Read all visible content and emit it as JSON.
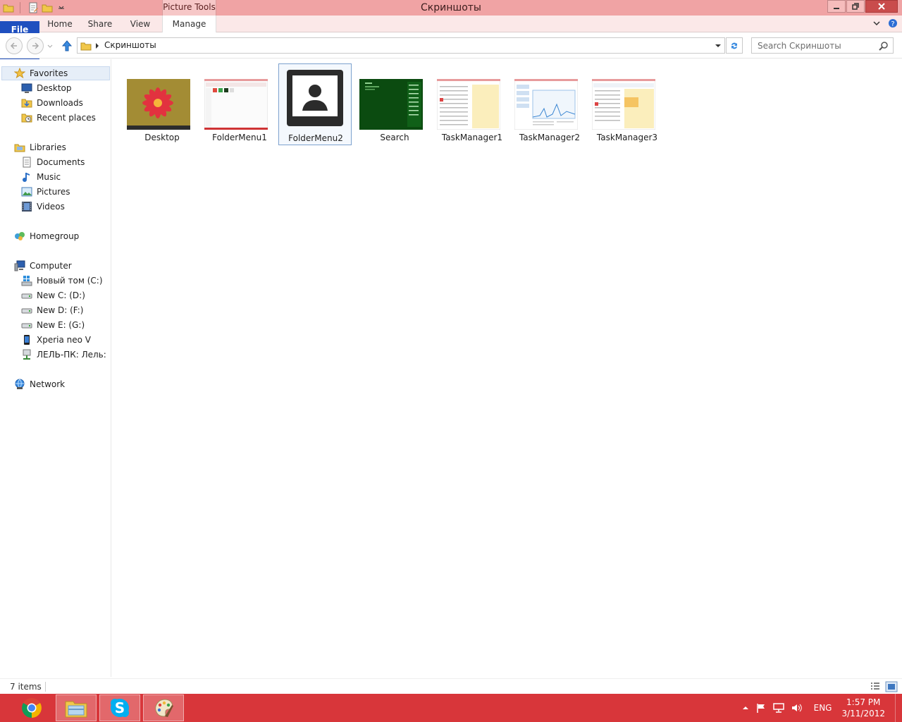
{
  "window": {
    "title": "Скриншоты",
    "context_tab": "Picture Tools"
  },
  "ribbon": {
    "tabs": [
      {
        "label": "File"
      },
      {
        "label": "Home"
      },
      {
        "label": "Share"
      },
      {
        "label": "View"
      },
      {
        "label": "Manage"
      }
    ]
  },
  "address": {
    "path": "Скриншоты",
    "search_placeholder": "Search Скриншоты"
  },
  "nav": {
    "favorites": {
      "label": "Favorites",
      "items": [
        "Desktop",
        "Downloads",
        "Recent places"
      ]
    },
    "libraries": {
      "label": "Libraries",
      "items": [
        "Documents",
        "Music",
        "Pictures",
        "Videos"
      ]
    },
    "homegroup": "Homegroup",
    "computer": {
      "label": "Computer",
      "items": [
        "Новый том (C:)",
        "New C: (D:)",
        "New D: (F:)",
        "New E: (G:)",
        "Xperia neo V",
        "ЛЕЛЬ-ПК: Лель:"
      ]
    },
    "network": "Network"
  },
  "files": [
    {
      "name": "Desktop",
      "kind": "photo-flower"
    },
    {
      "name": "FolderMenu1",
      "kind": "screenshot-light"
    },
    {
      "name": "FolderMenu2",
      "kind": "user-placeholder",
      "selected": true
    },
    {
      "name": "Search",
      "kind": "screenshot-green"
    },
    {
      "name": "TaskManager1",
      "kind": "screenshot-taskmgr"
    },
    {
      "name": "TaskManager2",
      "kind": "screenshot-taskmgr2"
    },
    {
      "name": "TaskManager3",
      "kind": "screenshot-taskmgr3"
    }
  ],
  "status": {
    "item_count": "7 items"
  },
  "taskbar": {
    "apps": [
      "chrome-icon",
      "explorer-icon",
      "skype-icon",
      "paint-icon"
    ],
    "language": "ENG",
    "time": "1:57 PM",
    "date": "3/11/2012"
  },
  "colors": {
    "titlebar": "#f0a3a4",
    "file_tab": "#1f4fbf",
    "taskbar": "#d8363a",
    "selection_border": "#7da2ce"
  }
}
